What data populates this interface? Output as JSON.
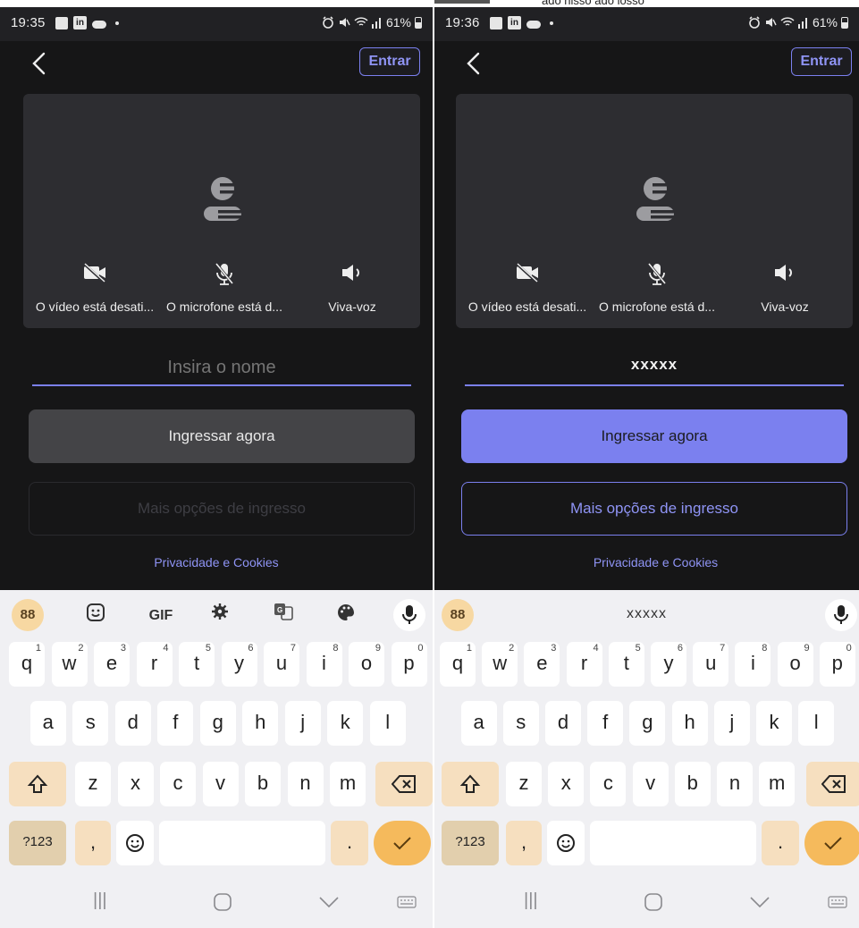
{
  "top_overlay_text": "ado nisso ado iosso",
  "left": {
    "status": {
      "time": "19:35",
      "linkedin": "in",
      "battery": "61%"
    },
    "header": {
      "entrar": "Entrar"
    },
    "controls": {
      "video": "O vídeo está desati...",
      "mic": "O microfone está d...",
      "speaker": "Viva-voz"
    },
    "name_field": {
      "value": "",
      "placeholder": "Insira o nome"
    },
    "join_button": "Ingressar agora",
    "more_button": "Mais opções de ingresso",
    "privacy": "Privacidade e Cookies",
    "keyboard": {
      "toolbar": {
        "gif": "GIF"
      },
      "shift_label": "",
      "sym": "?123",
      "comma": ",",
      "period": "."
    }
  },
  "right": {
    "status": {
      "time": "19:36",
      "linkedin": "in",
      "battery": "61%"
    },
    "header": {
      "entrar": "Entrar"
    },
    "controls": {
      "video": "O vídeo está desati...",
      "mic": "O microfone está d...",
      "speaker": "Viva-voz"
    },
    "name_field": {
      "value": "xxxxx",
      "placeholder": "Insira o nome"
    },
    "join_button": "Ingressar agora",
    "more_button": "Mais opções de ingresso",
    "privacy": "Privacidade e Cookies",
    "keyboard": {
      "suggestion": "xxxxx",
      "sym": "?123",
      "comma": ",",
      "period": "."
    }
  },
  "keys": {
    "row1": [
      {
        "k": "q",
        "n": "1"
      },
      {
        "k": "w",
        "n": "2"
      },
      {
        "k": "e",
        "n": "3"
      },
      {
        "k": "r",
        "n": "4"
      },
      {
        "k": "t",
        "n": "5"
      },
      {
        "k": "y",
        "n": "6"
      },
      {
        "k": "u",
        "n": "7"
      },
      {
        "k": "i",
        "n": "8"
      },
      {
        "k": "o",
        "n": "9"
      },
      {
        "k": "p",
        "n": "0"
      }
    ],
    "row2": [
      "a",
      "s",
      "d",
      "f",
      "g",
      "h",
      "j",
      "k",
      "l"
    ],
    "row3": [
      "z",
      "x",
      "c",
      "v",
      "b",
      "n",
      "m"
    ]
  },
  "colors": {
    "background": "#161617",
    "card": "#2d2d31",
    "accent": "#7b80ef",
    "keyboard": "#f0f0f3",
    "key_warm": "#f6dfbf",
    "enter_key": "#f5ba5c"
  }
}
